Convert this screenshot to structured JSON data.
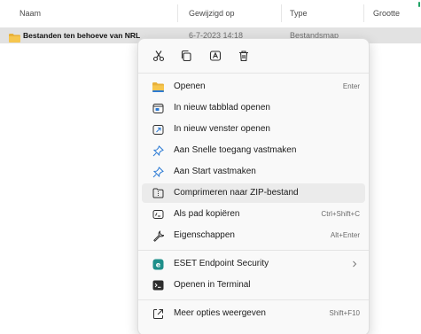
{
  "columns": {
    "name": "Naam",
    "modified": "Gewijzigd op",
    "type": "Type",
    "size": "Grootte"
  },
  "file_row": {
    "name": "Bestanden ten behoeve van NRL",
    "modified": "6-7-2023 14:18",
    "type": "Bestandsmap"
  },
  "context_menu": {
    "quick_actions": [
      {
        "name": "cut",
        "icon": "scissors-icon"
      },
      {
        "name": "copy",
        "icon": "copy-icon"
      },
      {
        "name": "rename",
        "icon": "rename-icon"
      },
      {
        "name": "delete",
        "icon": "trash-icon"
      }
    ],
    "items": [
      {
        "label": "Openen",
        "shortcut": "Enter",
        "icon": "folder-icon"
      },
      {
        "label": "In nieuw tabblad openen",
        "shortcut": "",
        "icon": "new-tab-icon"
      },
      {
        "label": "In nieuw venster openen",
        "shortcut": "",
        "icon": "new-window-icon"
      },
      {
        "label": "Aan Snelle toegang vastmaken",
        "shortcut": "",
        "icon": "pin-icon"
      },
      {
        "label": "Aan Start vastmaken",
        "shortcut": "",
        "icon": "pin-icon"
      },
      {
        "label": "Comprimeren naar ZIP-bestand",
        "shortcut": "",
        "icon": "zip-icon"
      },
      {
        "label": "Als pad kopiëren",
        "shortcut": "Ctrl+Shift+C",
        "icon": "copy-path-icon"
      },
      {
        "label": "Eigenschappen",
        "shortcut": "Alt+Enter",
        "icon": "wrench-icon"
      },
      {
        "label": "ESET Endpoint Security",
        "shortcut": "",
        "icon": "eset-icon"
      },
      {
        "label": "Openen in Terminal",
        "shortcut": "",
        "icon": "terminal-icon"
      },
      {
        "label": "Meer opties weergeven",
        "shortcut": "Shift+F10",
        "icon": "more-options-icon"
      }
    ]
  },
  "colors": {
    "accent": "#2b7ad4",
    "folder": "#f2c14e",
    "selection": "#e2e2e2",
    "menu_background": "#f9f9f9",
    "scrollbar": "#21a366"
  }
}
